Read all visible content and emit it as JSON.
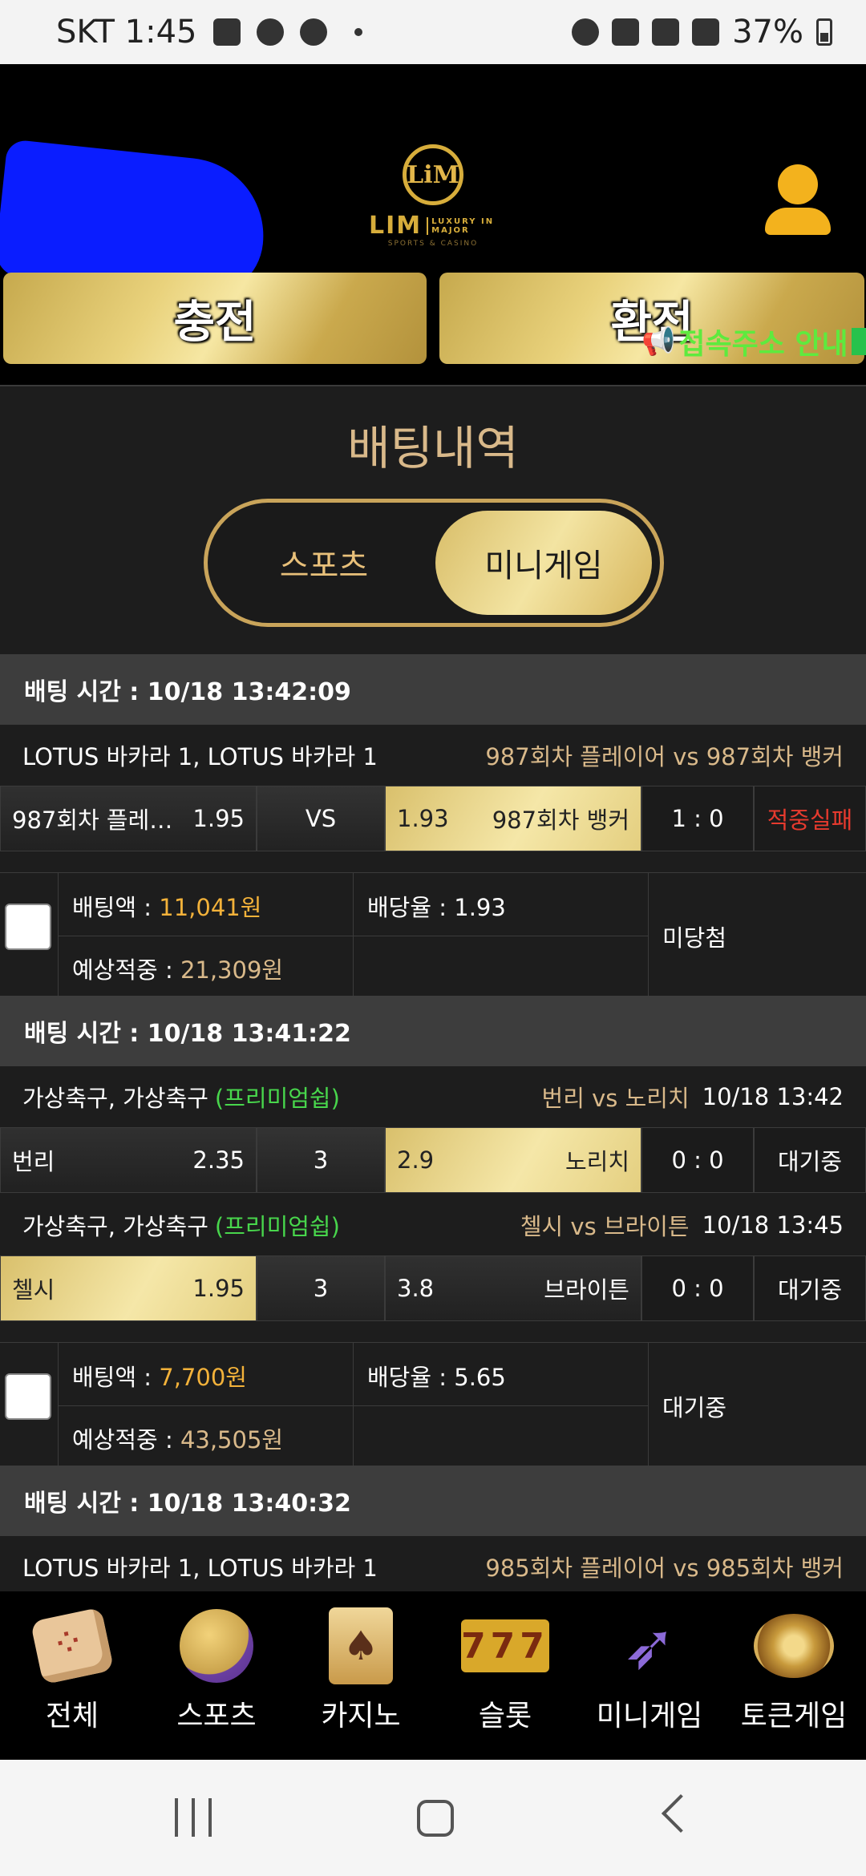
{
  "status_bar": {
    "carrier_time": "SKT 1:45",
    "battery": "37%"
  },
  "header": {
    "logo_mark": "LiM",
    "logo_text": "LIM",
    "logo_sub": "LUXURY IN MAJOR",
    "logo_tag": "SPORTS & CASINO",
    "deposit_label": "충전",
    "withdraw_label": "환전",
    "notice": "접속주소 안내"
  },
  "page": {
    "title": "배팅내역",
    "tabs": [
      {
        "label": "스포츠",
        "active": false
      },
      {
        "label": "미니게임",
        "active": true
      }
    ]
  },
  "bets": [
    {
      "time_label": "배팅 시간 : 10/18 13:42:09",
      "games": [
        {
          "name": "LOTUS 바카라 1, LOTUS 바카라 1",
          "premium": "",
          "match": "987회차 플레이어  vs  987회차 뱅커",
          "match_time": "",
          "home": "987회차 플레…",
          "home_odd": "1.95",
          "mid": "VS",
          "away_odd": "1.93",
          "away": "987회차 뱅커",
          "score": "1 : 0",
          "status": "적중실패"
        }
      ],
      "amount_label": "배팅액 : ",
      "amount": "11,041원",
      "rate_label": "배당율 : ",
      "rate": "1.93",
      "expected_label": "예상적중 : ",
      "expected": "21,309원",
      "result": "미당첨"
    },
    {
      "time_label": "배팅 시간 : 10/18 13:41:22",
      "games": [
        {
          "name": "가상축구, 가상축구",
          "premium": "(프리미엄쉽)",
          "match": "번리  vs  노리치",
          "match_time": "10/18 13:42",
          "home": "번리",
          "home_odd": "2.35",
          "mid": "3",
          "away_odd": "2.9",
          "away": "노리치",
          "score": "0 : 0",
          "status": "대기중"
        },
        {
          "name": "가상축구, 가상축구",
          "premium": "(프리미엄쉽)",
          "match": "첼시  vs  브라이튼",
          "match_time": "10/18 13:45",
          "home": "첼시",
          "home_odd": "1.95",
          "mid": "3",
          "away_odd": "3.8",
          "away": "브라이튼",
          "score": "0 : 0",
          "status": "대기중"
        }
      ],
      "amount_label": "배팅액 : ",
      "amount": "7,700원",
      "rate_label": "배당율 : ",
      "rate": "5.65",
      "expected_label": "예상적중 : ",
      "expected": "43,505원",
      "result": "대기중"
    },
    {
      "time_label": "배팅 시간 : 10/18 13:40:32",
      "games": [
        {
          "name": "LOTUS 바카라 1, LOTUS 바카라 1",
          "premium": "",
          "match": "985회차 플레이어  vs  985회차 뱅커",
          "match_time": ""
        }
      ]
    }
  ],
  "bottom_nav": [
    {
      "label": "전체",
      "icon": "dice-icon"
    },
    {
      "label": "스포츠",
      "icon": "soccer-ball-icon"
    },
    {
      "label": "카지노",
      "icon": "playing-cards-icon"
    },
    {
      "label": "슬롯",
      "icon": "slot-777-icon"
    },
    {
      "label": "미니게임",
      "icon": "rocket-icon"
    },
    {
      "label": "토큰게임",
      "icon": "roulette-icon"
    }
  ],
  "slot_text": "777"
}
